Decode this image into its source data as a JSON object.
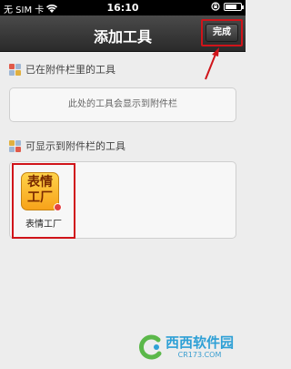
{
  "status_bar": {
    "carrier": "无 SIM 卡",
    "time": "16:10"
  },
  "nav": {
    "title": "添加工具",
    "done_label": "完成"
  },
  "sections": [
    {
      "title": "已在附件栏里的工具",
      "empty_hint": "此处的工具会显示到附件栏"
    },
    {
      "title": "可显示到附件栏的工具"
    }
  ],
  "tools": [
    {
      "label": "表情工厂",
      "icon": "emoji-factory-icon",
      "icon_text": "表情工厂"
    }
  ],
  "watermark": {
    "main": "西西软件园",
    "sub": "CR173.COM"
  },
  "colors": {
    "annotation_red": "#d0141a",
    "nav_bg": "#333333",
    "page_bg": "#ededed"
  }
}
